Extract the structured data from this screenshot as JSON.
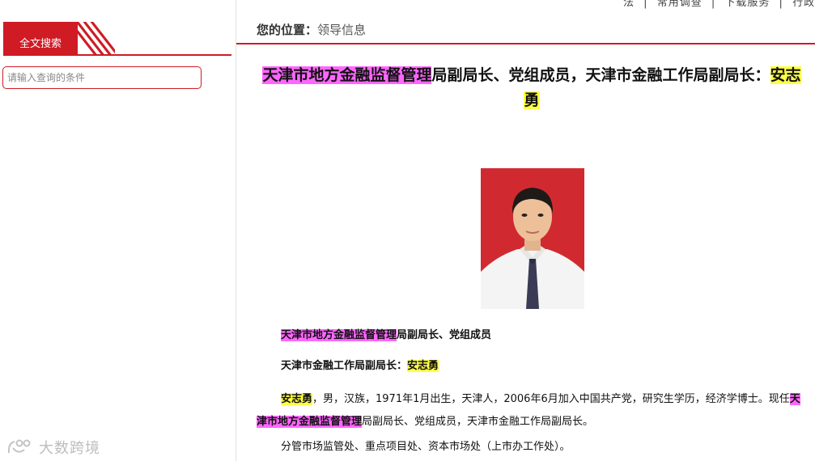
{
  "top_nav": {
    "items": [
      "法",
      "|",
      "常用调查",
      "|",
      "下载服务",
      "|",
      "行政审批"
    ]
  },
  "sidebar": {
    "search_tab_label": "全文搜索",
    "search_placeholder": "请输入查询的条件",
    "watermark": "大数跨境"
  },
  "breadcrumb": {
    "label": "您的位置：",
    "current": "领导信息"
  },
  "article": {
    "title_part1": "天津市地方金融监督管理",
    "title_part2": "局副局长、党组成员，天津市金融工作局副局长：",
    "title_part3": "安志勇",
    "role1_hl": "天津市地方金融监督管理",
    "role1_rest": "局副局长、党组成员",
    "role2_text": "天津市金融工作局副局长：",
    "role2_name": "安志勇",
    "bio_name": "安志勇",
    "bio_text1": "，男，汉族，1971年1月出生，天津人，2006年6月加入中国共产党，研究生学历，经济学博士。现任",
    "bio_hl": "天津市地方金融监督管理",
    "bio_text2": "局副局长、党组成员，天津市金融工作局副局长。",
    "duties": "分管市场监管处、重点项目处、资本市场处（上市办工作处）。"
  },
  "colors": {
    "brand_red": "#cf1b24",
    "highlight_pink": "#ff66ff",
    "highlight_yellow": "#ffff44"
  }
}
